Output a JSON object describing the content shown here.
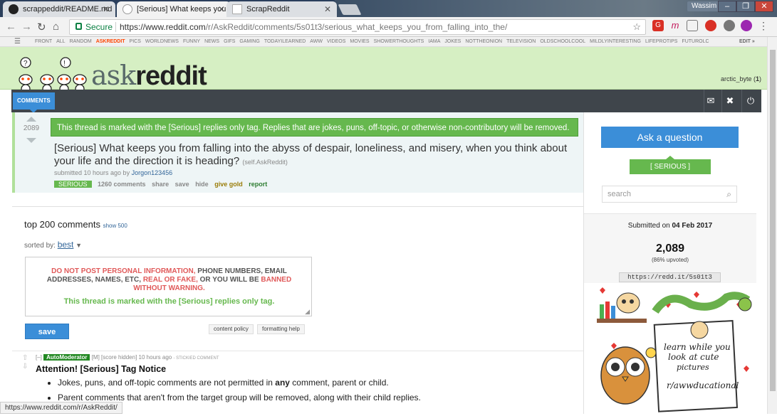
{
  "browser": {
    "tabs": [
      {
        "label": "scrappeddit/README.md",
        "icon": "github-icon"
      },
      {
        "label": "[Serious] What keeps you",
        "icon": "reddit-icon"
      },
      {
        "label": "ScrapReddit",
        "icon": "document-icon"
      }
    ],
    "user": "Wassim",
    "secure": "Secure",
    "url_host": "https://www.reddit.com",
    "url_path": "/r/AskReddit/comments/5s01t3/serious_what_keeps_you_from_falling_into_the/",
    "status_url": "https://www.reddit.com/r/AskReddit/"
  },
  "srbar": {
    "items": [
      "FRONT",
      "ALL",
      "RANDOM",
      "ASKREDDIT",
      "PICS",
      "WORLDNEWS",
      "FUNNY",
      "NEWS",
      "GIFS",
      "GAMING",
      "TODAYILEARNED",
      "AWW",
      "VIDEOS",
      "MOVIES",
      "SHOWERTHOUGHTS",
      "IAMA",
      "JOKES",
      "NOTTHEONION",
      "TELEVISION",
      "OLDSCHOOLCOOL",
      "MILDLYINTERESTING",
      "LIFEPROTIPS",
      "FUTUROLC"
    ],
    "selected": "ASKREDDIT",
    "edit": "EDIT »"
  },
  "header": {
    "logo_light": "ask",
    "logo_bold": "reddit",
    "username": "arctic_byte",
    "karma": "1",
    "tab": "COMMENTS"
  },
  "post": {
    "score": "2089",
    "notice": "This thread is marked with the [Serious] replies only tag. Replies that are jokes, puns, off-topic, or otherwise non-contributory will be removed.",
    "title": "[Serious] What keeps you from falling into the abyss of despair, loneliness, and misery, when you think about your life and the direction it is heading?",
    "domain": "(self.AskReddit)",
    "submitted": "submitted 10 hours ago by",
    "author": "Jorgon123456",
    "flair": "SERIOUS",
    "comments_count": "1260 comments",
    "actions": [
      "share",
      "save",
      "hide",
      "give gold",
      "report"
    ]
  },
  "comments": {
    "top": "top 200 comments",
    "show": "show 500",
    "sorted_label": "sorted by:",
    "sort": "best",
    "rules_red1": "DO NOT POST PERSONAL INFORMATION,",
    "rules_gray1": " PHONE NUMBERS, EMAIL ADDRESSES, NAMES, ETC,",
    "rules_red2": " REAL OR FAKE,",
    "rules_gray2": " OR YOU WILL BE",
    "rules_red3": " BANNED WITHOUT WARNING.",
    "rules_green": "This thread is marked with the [Serious] replies only tag.",
    "save": "save",
    "content_policy": "content policy",
    "formatting_help": "formatting help",
    "first": {
      "collapse": "[–]",
      "author": "AutoModerator",
      "mod": "[M]",
      "score": "[score hidden]",
      "time": "10 hours ago",
      "stickied": "- STICKIED COMMENT",
      "title": "Attention! [Serious] Tag Notice",
      "bullet1_a": "Jokes, puns, and off-topic comments are not permitted in ",
      "bullet1_b": "any",
      "bullet1_c": " comment, parent or child.",
      "bullet2": "Parent comments that aren't from the target group will be removed, along with their child replies."
    }
  },
  "sidebar": {
    "ask": "Ask a question",
    "serious": "[ SERIOUS ]",
    "search_placeholder": "search",
    "submitted_on": "Submitted on",
    "date": "04 Feb 2017",
    "score": "2,089",
    "upvoted": "(86% upvoted)",
    "shortlink": "https://redd.it/5s01t3",
    "ad_text1": "learn while you",
    "ad_text2": "look at cute",
    "ad_text3": "pictures",
    "ad_sub": "r/awwducational"
  },
  "colors": {
    "accent": "#3b8ed8",
    "serious_green": "#66b84e",
    "header_green": "#d6efc3",
    "orangered": "#ff4500"
  }
}
